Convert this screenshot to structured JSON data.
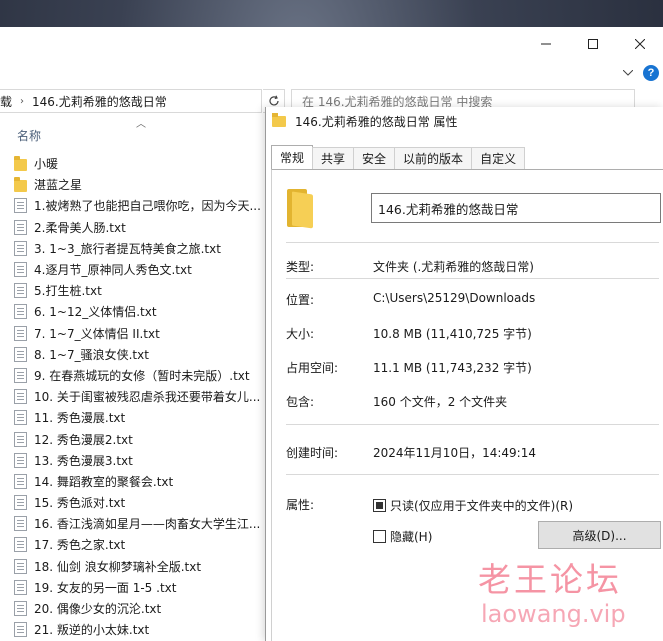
{
  "explorer": {
    "address_prev": "载",
    "address_current": "146.尤莉希雅的悠哉日常",
    "search_placeholder": "在 146.尤莉希雅的悠哉日常 中搜索",
    "column_name": "名称",
    "items": [
      {
        "type": "folder",
        "name": "小暖"
      },
      {
        "type": "folder",
        "name": "湛蓝之星"
      },
      {
        "type": "txt",
        "name": "1.被烤熟了也能把自己喂你吃，因为今天..."
      },
      {
        "type": "txt",
        "name": "2.柔骨美人肠.txt"
      },
      {
        "type": "txt",
        "name": "3. 1~3_旅行者提瓦特美食之旅.txt"
      },
      {
        "type": "txt",
        "name": "4.逐月节_原神同人秀色文.txt"
      },
      {
        "type": "txt",
        "name": "5.打生桩.txt"
      },
      {
        "type": "txt",
        "name": "6. 1~12_义体情侣.txt"
      },
      {
        "type": "txt",
        "name": "7. 1~7_义体情侣 II.txt"
      },
      {
        "type": "txt",
        "name": "8. 1~7_骚浪女侠.txt"
      },
      {
        "type": "txt",
        "name": "9. 在春燕城玩的女修（暂时未完版）.txt"
      },
      {
        "type": "txt",
        "name": "10. 关于闺蜜被残忍虐杀我还要带着女儿..."
      },
      {
        "type": "txt",
        "name": "11. 秀色漫展.txt"
      },
      {
        "type": "txt",
        "name": "12. 秀色漫展2.txt"
      },
      {
        "type": "txt",
        "name": "13. 秀色漫展3.txt"
      },
      {
        "type": "txt",
        "name": "14. 舞蹈教室的聚餐会.txt"
      },
      {
        "type": "txt",
        "name": "15. 秀色派对.txt"
      },
      {
        "type": "txt",
        "name": "16. 香江浅滴如星月——肉畜女大学生江..."
      },
      {
        "type": "txt",
        "name": "17. 秀色之家.txt"
      },
      {
        "type": "txt",
        "name": "18. 仙剑 浪女柳梦璃补全版.txt"
      },
      {
        "type": "txt",
        "name": "19. 女友的另一面  1-5  .txt"
      },
      {
        "type": "txt",
        "name": "20. 偶像少女的沉沦.txt"
      },
      {
        "type": "txt",
        "name": "21. 叛逆的小太妹.txt"
      }
    ]
  },
  "dialog": {
    "title": "146.尤莉希雅的悠哉日常 属性",
    "tabs": [
      "常规",
      "共享",
      "安全",
      "以前的版本",
      "自定义"
    ],
    "folder_name": "146.尤莉希雅的悠哉日常",
    "type_label": "类型:",
    "type_value": "文件夹 (.尤莉希雅的悠哉日常)",
    "location_label": "位置:",
    "location_value": "C:\\Users\\25129\\Downloads",
    "size_label": "大小:",
    "size_value": "10.8 MB (11,410,725 字节)",
    "disk_label": "占用空间:",
    "disk_value": "11.1 MB (11,743,232 字节)",
    "contains_label": "包含:",
    "contains_value": "160 个文件，2 个文件夹",
    "created_label": "创建时间:",
    "created_value": "2024年11月10日，14:49:14",
    "attributes_label": "属性:",
    "readonly_label": "只读(仅应用于文件夹中的文件)(R)",
    "hidden_label": "隐藏(H)",
    "advanced_button": "高级(D)..."
  },
  "watermark": {
    "cn": "老王论坛",
    "url": "laowang.vip"
  }
}
